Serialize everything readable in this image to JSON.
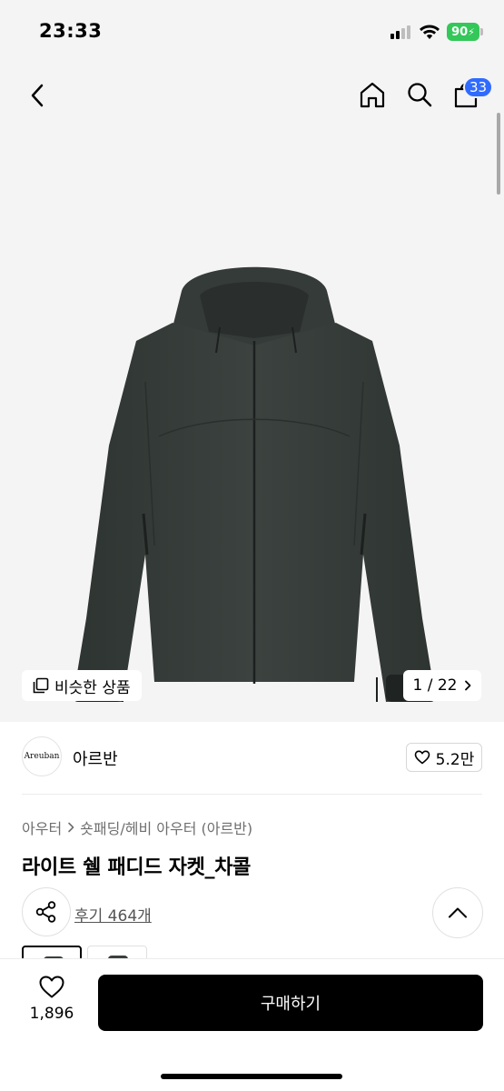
{
  "status_bar": {
    "time": "23:33",
    "battery": "90",
    "icons": [
      "signal-icon",
      "wifi-icon",
      "battery-icon"
    ]
  },
  "header": {
    "icons": [
      "back-icon",
      "home-icon",
      "search-icon",
      "cart-icon"
    ],
    "cart_count": "33"
  },
  "gallery": {
    "similar_label": "비슷한 상품",
    "counter": "1 / 22"
  },
  "brand": {
    "logo_text": "Areuban",
    "name": "아르반",
    "likes": "5.2만"
  },
  "product": {
    "breadcrumb": [
      "아우터",
      "숏패딩/헤비 아우터 (아르반)"
    ],
    "title": "라이트 쉘 패디드 자켓_차콜",
    "review_link": "후기 464개"
  },
  "bottom_bar": {
    "wish_count": "1,896",
    "buy_label": "구매하기"
  },
  "colors": {
    "accent_badge": "#2f6bff",
    "battery": "#34c759",
    "jacket": "#3a3f3c",
    "primary_button": "#000000"
  }
}
